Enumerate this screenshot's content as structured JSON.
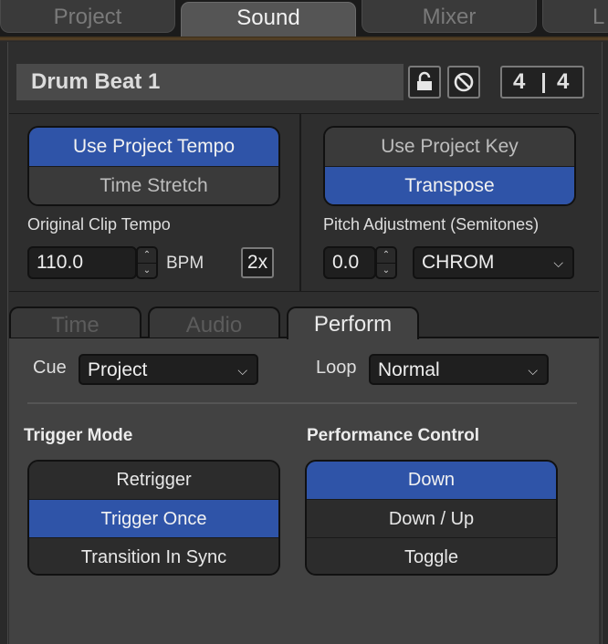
{
  "tabs": [
    {
      "label": "Project",
      "active": false
    },
    {
      "label": "Sound",
      "active": true
    },
    {
      "label": "Mixer",
      "active": false
    },
    {
      "label": "L",
      "active": false
    }
  ],
  "clip": {
    "name": "Drum Beat 1",
    "lock_icon": "lock-icon",
    "disable_icon": "prohibit-icon",
    "time_signature": {
      "numerator": "4",
      "denominator": "4"
    }
  },
  "tempo": {
    "options": [
      {
        "label": "Use Project Tempo",
        "selected": true
      },
      {
        "label": "Time Stretch",
        "selected": false
      }
    ],
    "original_label": "Original Clip Tempo",
    "value": "110.0",
    "unit": "BPM",
    "double_label": "2x"
  },
  "key": {
    "options": [
      {
        "label": "Use Project Key",
        "selected": false
      },
      {
        "label": "Transpose",
        "selected": true
      }
    ],
    "pitch_label": "Pitch Adjustment (Semitones)",
    "value": "0.0",
    "scale": "CHROM"
  },
  "subtabs": [
    {
      "label": "Time",
      "active": false
    },
    {
      "label": "Audio",
      "active": false
    },
    {
      "label": "Perform",
      "active": true
    }
  ],
  "perform": {
    "cue_label": "Cue",
    "cue_value": "Project",
    "loop_label": "Loop",
    "loop_value": "Normal",
    "trigger_heading": "Trigger Mode",
    "trigger_options": [
      {
        "label": "Retrigger",
        "selected": false
      },
      {
        "label": "Trigger Once",
        "selected": true
      },
      {
        "label": "Transition In Sync",
        "selected": false
      }
    ],
    "control_heading": "Performance Control",
    "control_options": [
      {
        "label": "Down",
        "selected": true
      },
      {
        "label": "Down / Up",
        "selected": false
      },
      {
        "label": "Toggle",
        "selected": false
      }
    ]
  },
  "colors": {
    "selected": "#2f54a8",
    "accent_line": "#5a4426"
  }
}
